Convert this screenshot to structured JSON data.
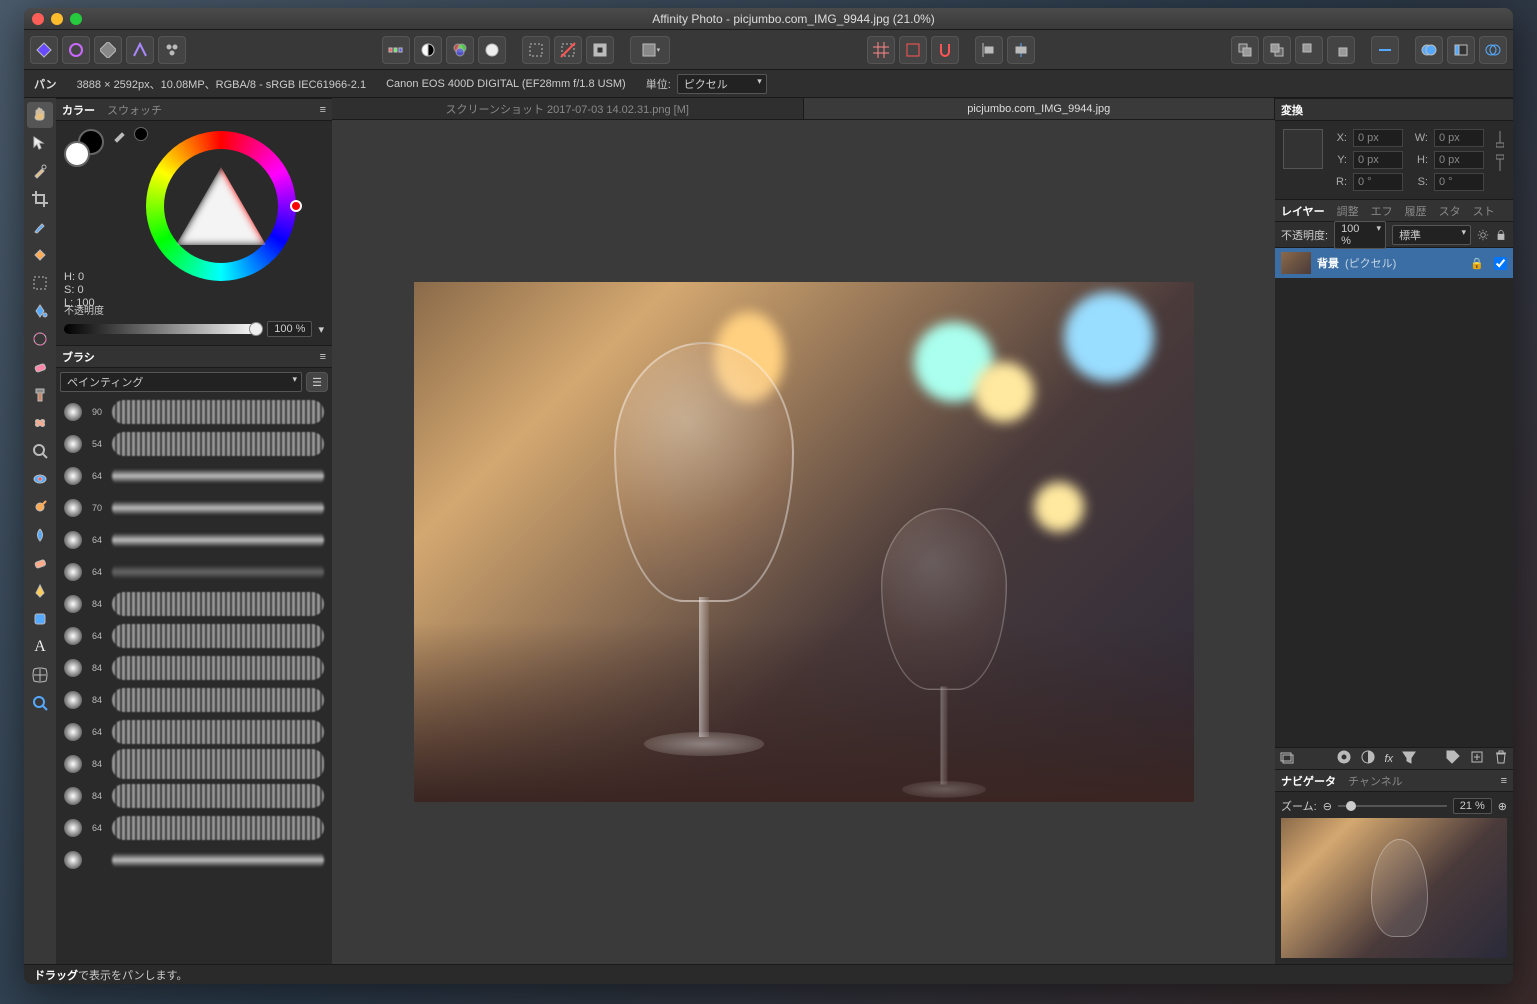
{
  "window_title": "Affinity Photo - picjumbo.com_IMG_9944.jpg (21.0%)",
  "context": {
    "tool_label": "パン",
    "image_info": "3888 × 2592px、10.08MP、RGBA/8 - sRGB IEC61966-2.1",
    "camera_info": "Canon EOS 400D DIGITAL (EF28mm f/1.8 USM)",
    "unit_label": "単位:",
    "unit_value": "ピクセル"
  },
  "doc_tabs": {
    "tab1": "スクリーンショット 2017-07-03 14.02.31.png [M]",
    "tab2": "picjumbo.com_IMG_9944.jpg"
  },
  "color_panel": {
    "tab_color": "カラー",
    "tab_swatch": "スウォッチ",
    "hsl_h": "H: 0",
    "hsl_s": "S: 0",
    "hsl_l": "L: 100",
    "opacity_label": "不透明度",
    "opacity_value": "100 %"
  },
  "brush_panel": {
    "tab_brush": "ブラシ",
    "category": "ペインティング",
    "sizes": [
      "90",
      "54",
      "64",
      "70",
      "64",
      "64",
      "84",
      "64",
      "84",
      "84",
      "64",
      "84",
      "84",
      "64"
    ]
  },
  "transform_panel": {
    "tab": "変換",
    "x_label": "X:",
    "x_val": "0 px",
    "y_label": "Y:",
    "y_val": "0 px",
    "w_label": "W:",
    "w_val": "0 px",
    "h_label": "H:",
    "h_val": "0 px",
    "r_label": "R:",
    "r_val": "0 °",
    "s_label": "S:",
    "s_val": "0 °"
  },
  "layers_panel": {
    "tab_layers": "レイヤー",
    "tab_adjust": "調整",
    "tab_fx": "エフ",
    "tab_history": "履歴",
    "tab_styles": "スタ",
    "tab_stock": "スト",
    "opacity_label": "不透明度:",
    "opacity_val": "100 %",
    "blend_val": "標準",
    "layer_name": "背景",
    "layer_type": "(ピクセル)"
  },
  "nav_panel": {
    "tab_nav": "ナビゲータ",
    "tab_channel": "チャンネル",
    "zoom_label": "ズーム:",
    "zoom_val": "21 %"
  },
  "status": {
    "drag_bold": "ドラッグ",
    "drag_rest": "で表示をパンします。"
  }
}
